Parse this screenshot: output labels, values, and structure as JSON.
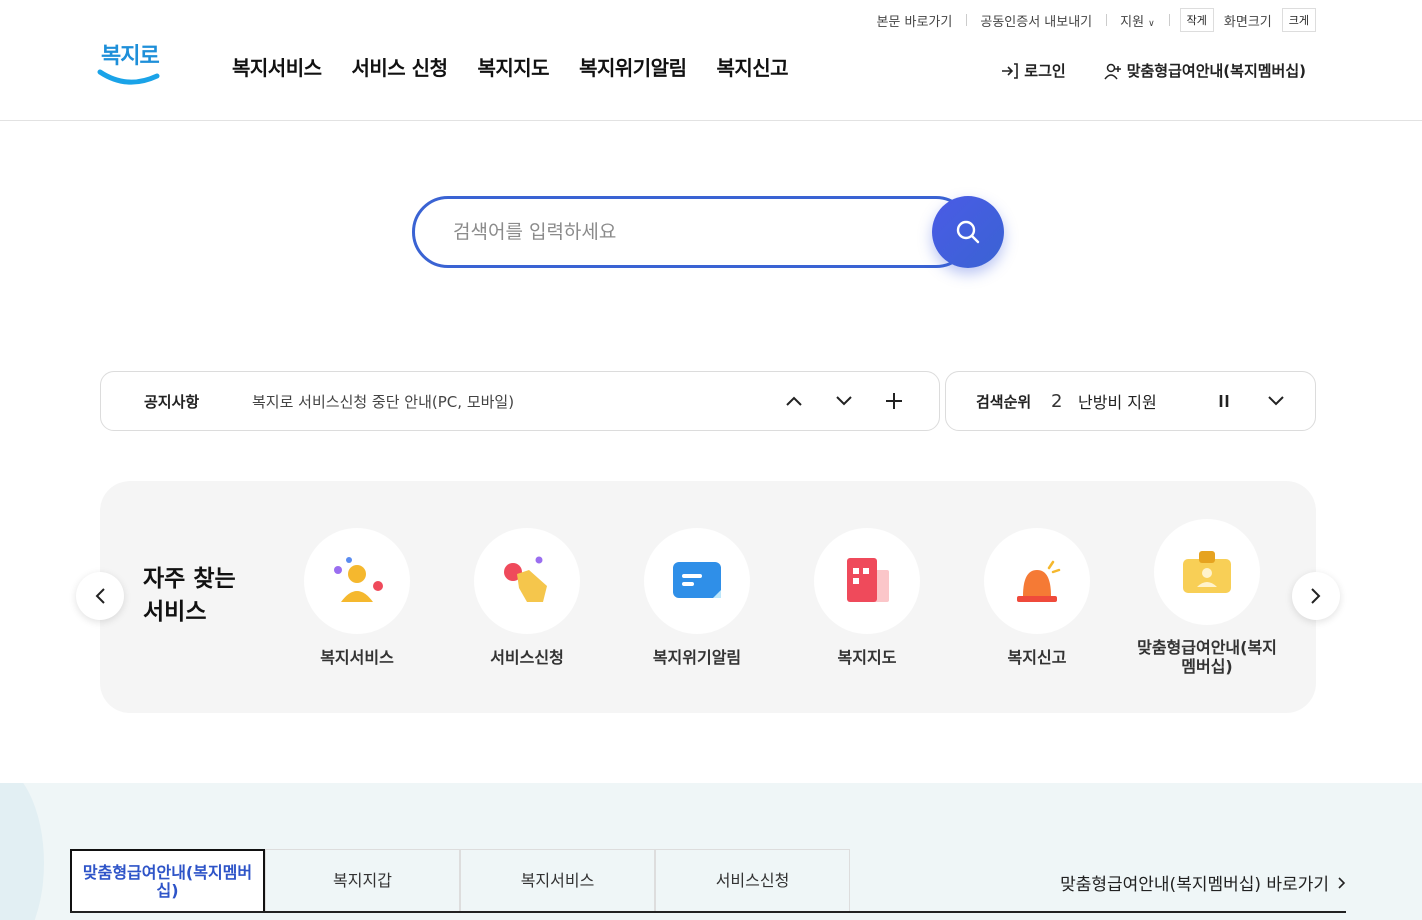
{
  "utility": {
    "skip_link": "본문 바로가기",
    "cert_export": "공동인증서 내보내기",
    "support": "지원",
    "size_small": "작게",
    "size_label": "화면크기",
    "size_large": "크게"
  },
  "header": {
    "logo_text": "복지로",
    "nav": [
      "복지서비스",
      "서비스 신청",
      "복지지도",
      "복지위기알림",
      "복지신고"
    ],
    "login": "로그인",
    "membership": "맞춤형급여안내(복지멤버십)"
  },
  "search": {
    "placeholder": "검색어를 입력하세요"
  },
  "notice": {
    "title": "공지사항",
    "text": "복지로 서비스신청 중단 안내(PC, 모바일)"
  },
  "ranking": {
    "title": "검색순위",
    "number": "2",
    "keyword": "난방비 지원"
  },
  "frequent": {
    "title": "자주 찾는 서비스",
    "items": [
      {
        "label": "복지서비스",
        "icon": "person-icon"
      },
      {
        "label": "서비스신청",
        "icon": "hand-tap-icon"
      },
      {
        "label": "복지위기알림",
        "icon": "message-icon"
      },
      {
        "label": "복지지도",
        "icon": "building-icon"
      },
      {
        "label": "복지신고",
        "icon": "siren-icon"
      },
      {
        "label": "맞춤형급여안내(복지멤버십)",
        "icon": "id-card-icon"
      }
    ]
  },
  "bottom": {
    "tabs": [
      "맞춤형급여안내(복지멤버십)",
      "복지지갑",
      "복지서비스",
      "서비스신청"
    ],
    "shortcut": "맞춤형급여안내(복지멤버십) 바로가기"
  },
  "colors": {
    "accent": "#3a63d3",
    "bottom_bg": "#eff6f7",
    "panel_bg": "#f5f5f5"
  }
}
